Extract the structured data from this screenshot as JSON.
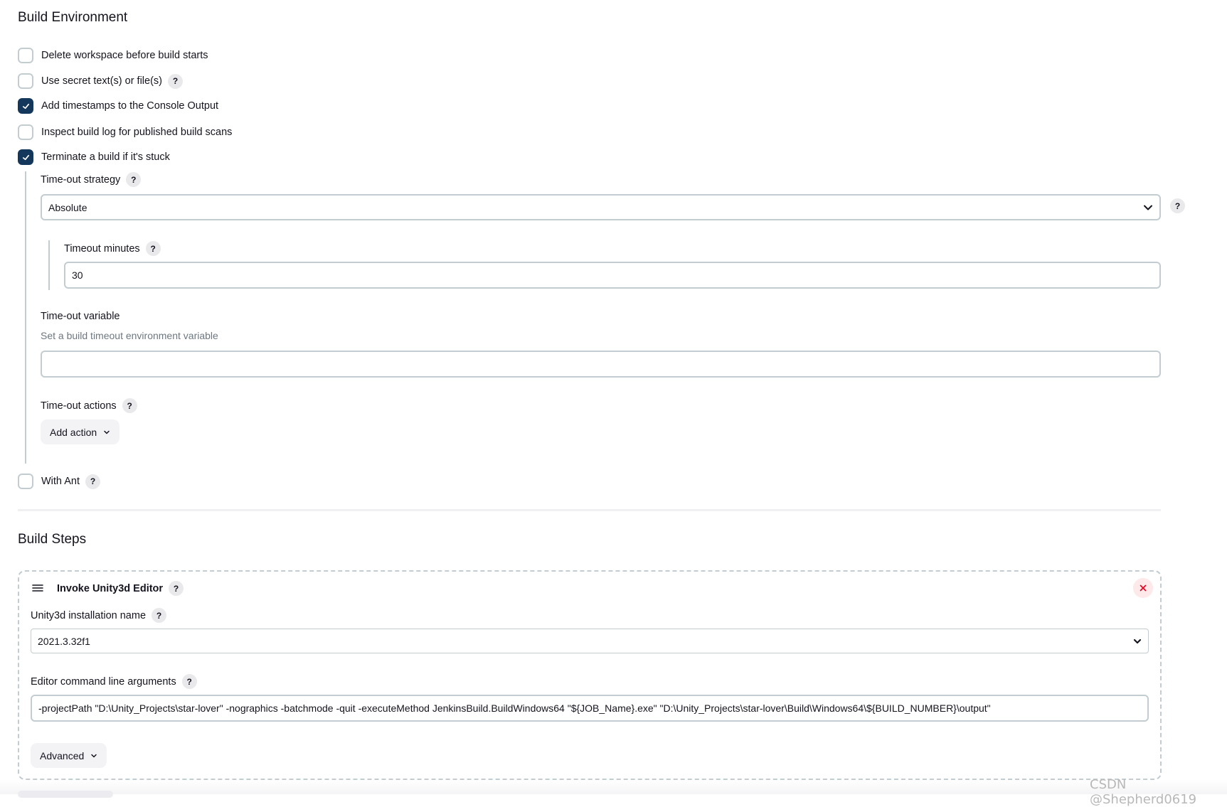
{
  "build_environment": {
    "title": "Build Environment",
    "options": [
      {
        "label": "Delete workspace before build starts",
        "checked": false,
        "help": false
      },
      {
        "label": "Use secret text(s) or file(s)",
        "checked": false,
        "help": true
      },
      {
        "label": "Add timestamps to the Console Output",
        "checked": true,
        "help": false
      },
      {
        "label": "Inspect build log for published build scans",
        "checked": false,
        "help": false
      },
      {
        "label": "Terminate a build if it's stuck",
        "checked": true,
        "help": false
      }
    ],
    "timeout_strategy": {
      "label": "Time-out strategy",
      "value": "Absolute"
    },
    "timeout_minutes": {
      "label": "Timeout minutes",
      "value": "30"
    },
    "timeout_variable": {
      "label": "Time-out variable",
      "description": "Set a build timeout environment variable",
      "value": ""
    },
    "timeout_actions": {
      "label": "Time-out actions",
      "add_action_label": "Add action"
    },
    "with_ant": {
      "label": "With Ant",
      "checked": false
    }
  },
  "build_steps": {
    "title": "Build Steps",
    "step": {
      "title": "Invoke Unity3d Editor",
      "installation_label": "Unity3d installation name",
      "installation_value": "2021.3.32f1",
      "args_label": "Editor command line arguments",
      "args_value": "-projectPath \"D:\\Unity_Projects\\star-lover\" -nographics -batchmode -quit -executeMethod JenkinsBuild.BuildWindows64 \"${JOB_Name}.exe\" \"D:\\Unity_Projects\\star-lover\\Build\\Windows64\\${BUILD_NUMBER}\\output\"",
      "advanced_label": "Advanced"
    }
  },
  "help_glyph": "?",
  "watermark": "CSDN @Shepherd0619",
  "colors": {
    "checkbox_checked": "#14385c",
    "close_icon": "#e6001f",
    "close_bg": "#fde8ea"
  }
}
